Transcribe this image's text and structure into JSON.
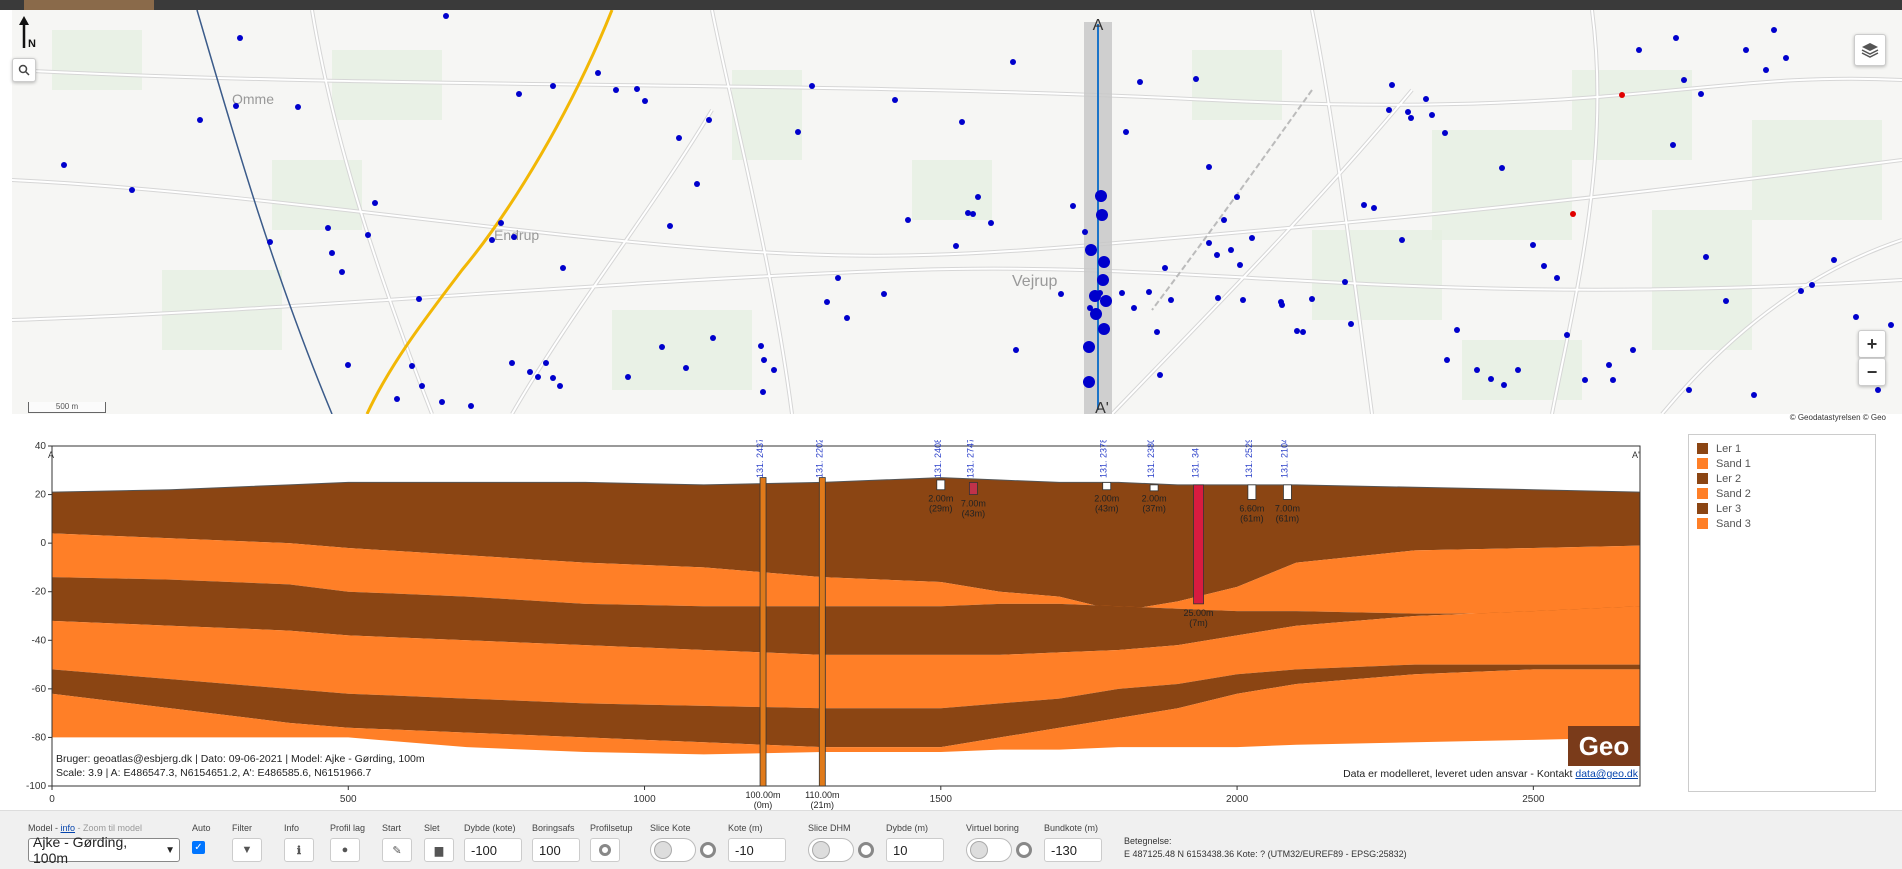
{
  "map": {
    "north_label": "N",
    "place_labels": [
      "Omme",
      "Endrup",
      "Vejrup"
    ],
    "section_start_label": "A",
    "section_end_label": "A'",
    "scale_label": "500 m",
    "attribution": "© Geodatastyrelsen  © Geo",
    "zoom_in_label": "+",
    "zoom_out_label": "−"
  },
  "profile": {
    "start_label": "A",
    "end_label": "A'",
    "y_ticks": [
      "40",
      "20",
      "0",
      "-20",
      "-40",
      "-60",
      "-80",
      "-100"
    ],
    "x_ticks": [
      "0",
      "500",
      "1000",
      "1500",
      "2000",
      "2500"
    ],
    "boreholes": [
      {
        "id": "131. 2437",
        "depth_label": "100.00m",
        "sub_label": "(0m)"
      },
      {
        "id": "131. 2202",
        "depth_label": "110.00m",
        "sub_label": "(21m)"
      },
      {
        "id": "131. 2408",
        "depth_label": "2.00m",
        "sub_label": "(29m)"
      },
      {
        "id": "131. 2747",
        "depth_label": "7.00m",
        "sub_label": "(43m)"
      },
      {
        "id": "131. 2378",
        "depth_label": "2.00m",
        "sub_label": "(43m)"
      },
      {
        "id": "131. 2380",
        "depth_label": "2.00m",
        "sub_label": "(37m)"
      },
      {
        "id": "131. 34",
        "depth_label": "25.00m",
        "sub_label": "(7m)"
      },
      {
        "id": "131. 2529",
        "depth_label": "6.60m",
        "sub_label": "(61m)"
      },
      {
        "id": "131. 2104",
        "depth_label": "7.00m",
        "sub_label": "(61m)"
      }
    ],
    "info_line1": "Bruger: geoatlas@esbjerg.dk | Dato: 09-06-2021 | Model: Ajke - Gørding, 100m",
    "info_line2": "Scale: 3.9 | A: E486547.3, N6154651.2, A': E486585.6, N6151966.7",
    "disclaimer": "Data er modelleret, leveret uden ansvar - Kontakt ",
    "contact_email": "data@geo.dk",
    "logo_text": "Geo"
  },
  "legend": {
    "items": [
      {
        "label": "Ler 1",
        "color": "#8B4513"
      },
      {
        "label": "Sand 1",
        "color": "#FF7F27"
      },
      {
        "label": "Ler 2",
        "color": "#8B4513"
      },
      {
        "label": "Sand 2",
        "color": "#FF7F27"
      },
      {
        "label": "Ler 3",
        "color": "#8B4513"
      },
      {
        "label": "Sand 3",
        "color": "#FF7F27"
      }
    ]
  },
  "toolbar": {
    "model_label": "Model - ",
    "model_info_link": "info",
    "model_zoom_label": " - Zoom til model",
    "model_value": "Ajke - Gørding, 100m",
    "auto_label": "Auto",
    "filter_label": "Filter",
    "info_label": "Info",
    "profil_lag_label": "Profil lag",
    "start_label": "Start",
    "slet_label": "Slet",
    "dybde_kote_label": "Dybde (kote)",
    "dybde_kote_value": "-100",
    "boringsafs_label": "Boringsafs",
    "boringsafs_value": "100",
    "profilsetup_label": "Profilsetup",
    "slice_kote_label": "Slice Kote",
    "kote_m_label": "Kote (m)",
    "kote_m_value": "-10",
    "slice_dhm_label": "Slice DHM",
    "dybde_m_label": "Dybde (m)",
    "dybde_m_value": "10",
    "virtuel_boring_label": "Virtuel boring",
    "bundkote_label": "Bundkote (m)",
    "bundkote_value": "-130",
    "betegnelse_label": "Betegnelse:",
    "coord_text": "E 487125.48 N 6153438.36 Kote: ? (UTM32/EUREF89 - EPSG:25832)"
  },
  "colors": {
    "clay": "#8B4513",
    "sand": "#FF7F27",
    "borehole_dot": "#0000cc",
    "section_line": "#1a73c8",
    "rail": "#f2b705"
  }
}
